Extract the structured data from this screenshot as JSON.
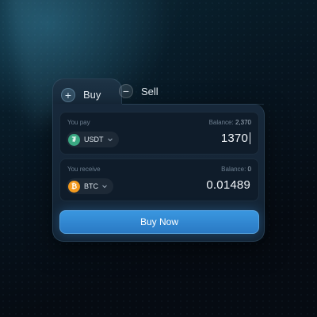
{
  "tabs": {
    "buy": {
      "label": "Buy",
      "icon": "plus-icon",
      "glyph": "+"
    },
    "sell": {
      "label": "Sell",
      "icon": "minus-icon",
      "glyph": "−"
    }
  },
  "pay": {
    "label": "You pay",
    "balance_label": "Balance:",
    "balance_value": "2,370",
    "token": "USDT",
    "token_icon": "tether-icon",
    "token_glyph": "₮",
    "amount": "1370"
  },
  "receive": {
    "label": "You receive",
    "balance_label": "Balance:",
    "balance_value": "0",
    "token": "BTC",
    "token_icon": "bitcoin-icon",
    "token_glyph": "₿",
    "amount": "0.01489"
  },
  "action": {
    "label": "Buy Now"
  },
  "colors": {
    "accent": "#3a97e0",
    "usdt": "#3aa882",
    "btc": "#f39a1e",
    "background": "#060b12"
  }
}
